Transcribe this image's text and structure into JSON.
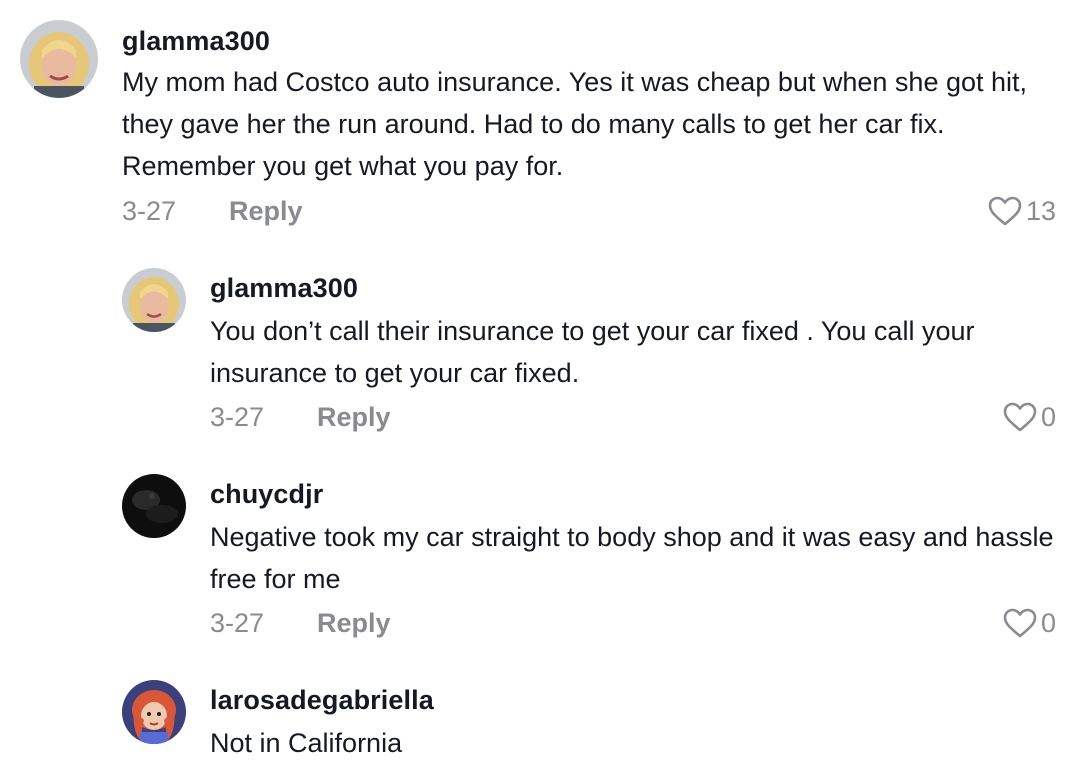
{
  "comments": [
    {
      "username": "glamma300",
      "text": "My mom had Costco auto insurance. Yes it was cheap but when she got hit, they gave her the run around. Had to do many calls to get her car fix. Remember you get what you pay for.",
      "date": "3-27",
      "reply_label": "Reply",
      "likes": "13",
      "avatar_icon": "user-photo-avatar"
    },
    {
      "username": "glamma300",
      "text": "You don’t call their insurance to get your car fixed . You call your insurance to get your car fixed.",
      "date": "3-27",
      "reply_label": "Reply",
      "likes": "0",
      "avatar_icon": "user-photo-avatar"
    },
    {
      "username": "chuycdjr",
      "text": "Negative took my car straight to body shop and it was easy and hassle free for me",
      "date": "3-27",
      "reply_label": "Reply",
      "likes": "0",
      "avatar_icon": "dark-photo-avatar"
    },
    {
      "username": "larosadegabriella",
      "text": "Not in California",
      "avatar_icon": "cartoon-avatar"
    }
  ],
  "colors": {
    "primary_text": "#161823",
    "secondary_text": "#8a8b91",
    "heart_outline": "#8a8b91",
    "background": "#ffffff"
  },
  "icons": {
    "like": "heart-outline-icon"
  }
}
